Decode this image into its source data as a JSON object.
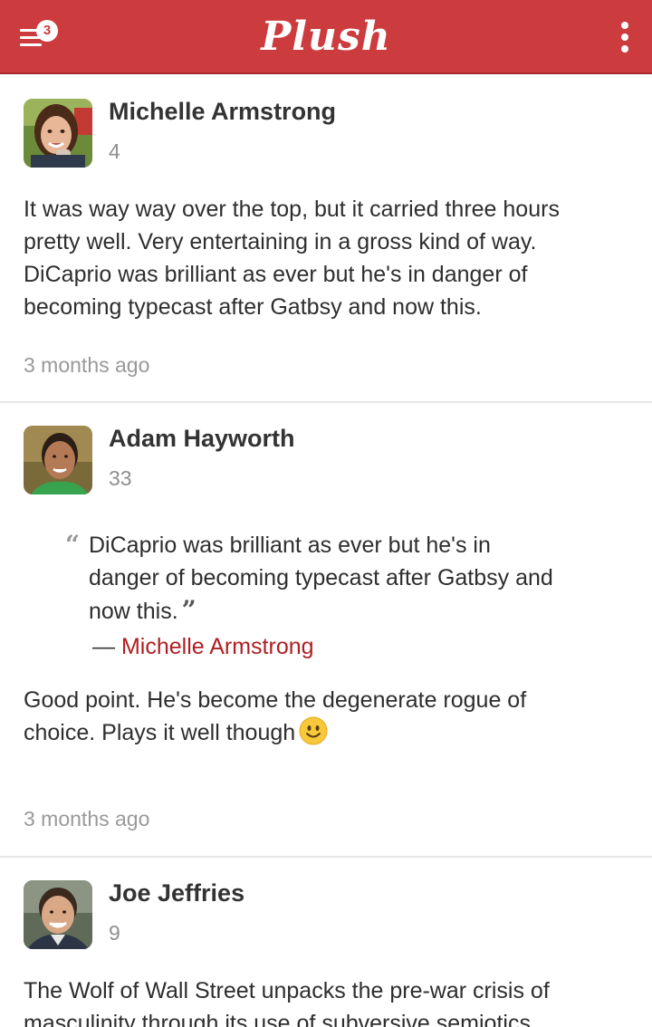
{
  "header": {
    "brand": "Plush",
    "menu_badge": "3",
    "menu_icon": "hamburger-menu-icon",
    "overflow_icon": "vertical-dots-icon",
    "colors": {
      "bar": "#cc3b3d",
      "link": "#b01e22"
    }
  },
  "comments": [
    {
      "author": "Michelle Armstrong",
      "score": "4",
      "body": "It was way way over the top, but it carried three hours pretty well. Very entertaining in a gross kind of way. DiCaprio was brilliant as ever but he's in danger of becoming typecast after Gatbsy and now this.",
      "time": "3 months ago"
    },
    {
      "author": "Adam Hayworth",
      "score": "33",
      "quote": {
        "text": "DiCaprio was brilliant as ever but he's in danger of becoming typecast after Gatbsy and now this.",
        "dash": "—",
        "source": "Michelle Armstrong"
      },
      "body": "Good point. He's become the degenerate rogue of choice. Plays it well though",
      "body_emoji": "smiley-face-icon",
      "time": "3 months ago"
    },
    {
      "author": "Joe Jeffries",
      "score": "9",
      "body": "The Wolf of Wall Street unpacks the pre-war crisis of masculinity through its use of subversive semiotics"
    }
  ]
}
